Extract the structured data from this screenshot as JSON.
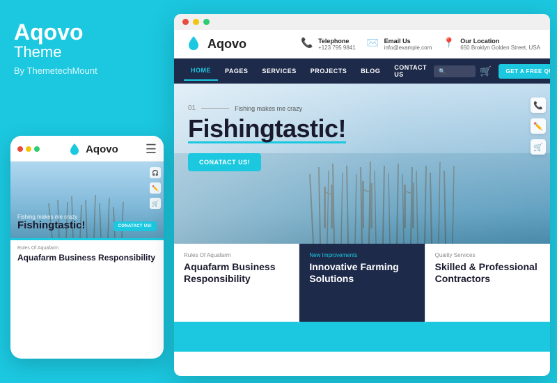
{
  "brand": {
    "name": "Aqovo",
    "subtitle": "Theme",
    "by": "By ThemetechMount"
  },
  "mobile": {
    "logo": "Aqovo",
    "hero": {
      "subtitle": "Fishing makes me crazy",
      "title": "Fishingtastic!",
      "cta": "CONATACT US!"
    },
    "card": {
      "label": "Rules Of Aquafarm",
      "title": "Aquafarm Business Responsibility"
    }
  },
  "desktop": {
    "titlebar_dots": [
      "red",
      "yellow",
      "green"
    ],
    "header": {
      "logo": "Aqovo",
      "telephone": {
        "label": "Telephone",
        "value": "+123 795 9841"
      },
      "email": {
        "label": "Email Us",
        "value": "info@example.com"
      },
      "location": {
        "label": "Our Location",
        "value": "650 Broklyn Golden Street, USA"
      }
    },
    "nav": {
      "items": [
        "HOME",
        "PAGES",
        "SERVICES",
        "PROJECTS",
        "BLOG",
        "CONTACT US"
      ],
      "cta": "GET A FREE QUOTES!"
    },
    "hero": {
      "line_num": "01",
      "subtitle": "Fishing makes me crazy",
      "title": "Fishingtastic!",
      "cta": "CONATACT US!"
    },
    "cards": [
      {
        "label": "Rules Of Aquafarm",
        "title": "Aquafarm Business Responsibility",
        "highlight": false
      },
      {
        "label": "New Improvements",
        "title": "Innovative Farming Solutions",
        "highlight": true
      },
      {
        "label": "Quality Services",
        "title": "Skilled & Professional Contractors",
        "highlight": false
      }
    ]
  },
  "colors": {
    "accent": "#1bc8e0",
    "dark_navy": "#1e2a4a",
    "bg_cyan": "#1bc8e0"
  }
}
